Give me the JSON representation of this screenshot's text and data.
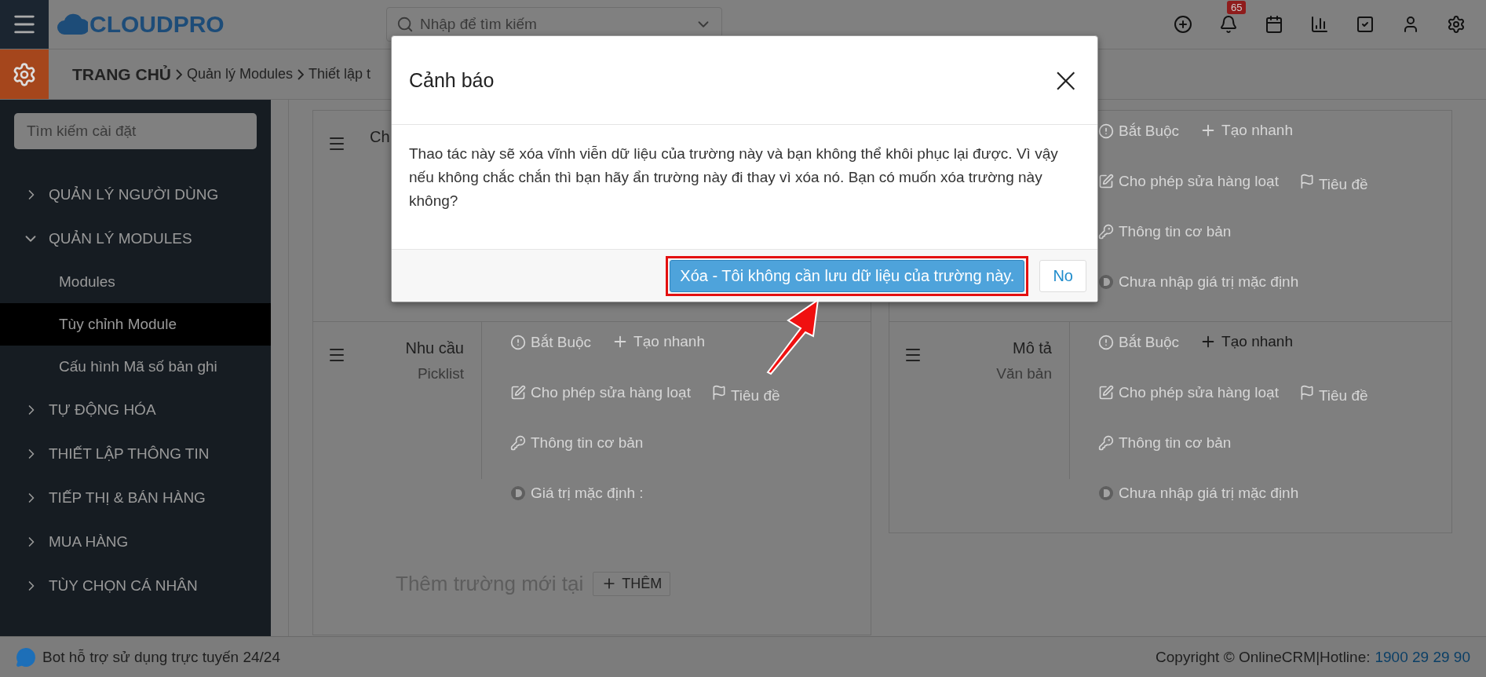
{
  "topbar": {
    "search_placeholder": "Nhập để tìm kiếm",
    "notification_count": "65",
    "logo": "CLOUDPRO"
  },
  "breadcrumb": [
    "TRANG CHỦ",
    "Quản lý Modules",
    "Thiết lập t"
  ],
  "sidebar": {
    "search_placeholder": "Tìm kiếm cài đặt",
    "items": [
      {
        "label": "QUẢN LÝ NGƯỜI DÙNG",
        "expanded": false
      },
      {
        "label": "QUẢN LÝ MODULES",
        "expanded": true,
        "children": [
          {
            "label": "Modules",
            "selected": false
          },
          {
            "label": "Tùy chỉnh Module",
            "selected": true
          },
          {
            "label": "Cấu hình Mã số bản ghi",
            "selected": false
          }
        ]
      },
      {
        "label": "TỰ ĐỘNG HÓA",
        "expanded": false
      },
      {
        "label": "THIẾT LẬP THÔNG TIN",
        "expanded": false
      },
      {
        "label": "TIẾP THỊ & BÁN HÀNG",
        "expanded": false
      },
      {
        "label": "MUA HÀNG",
        "expanded": false
      },
      {
        "label": "TÙY CHỌN CÁ NHÂN",
        "expanded": false
      }
    ]
  },
  "columns": [
    {
      "fields": [
        {
          "name": "Ch"
        },
        {
          "name": "Nhu cầu",
          "type": "Picklist",
          "options": [
            {
              "kind": "required",
              "label": "Bắt Buộc",
              "on": false
            },
            {
              "kind": "quick_create",
              "label": "Tạo nhanh",
              "on": false
            },
            {
              "kind": "mass_edit",
              "label": "Cho phép sửa hàng loạt",
              "on": false
            },
            {
              "kind": "header",
              "label": "Tiêu đề",
              "on": false
            },
            {
              "kind": "basic_info",
              "label": "Thông tin cơ bản",
              "on": false
            },
            {
              "kind": "default",
              "label": "Giá trị mặc định :",
              "on": false
            }
          ]
        }
      ],
      "add_field": {
        "label": "Thêm trường mới tại",
        "button": "THÊM"
      }
    },
    {
      "fields": [
        {
          "options": [
            {
              "kind": "required",
              "label": "Bắt Buộc",
              "on": false
            },
            {
              "kind": "quick_create",
              "label": "Tạo nhanh",
              "on": false
            },
            {
              "kind": "mass_edit",
              "label": "Cho phép sửa hàng loạt",
              "on": false
            },
            {
              "kind": "header",
              "label": "Tiêu đề",
              "on": false
            },
            {
              "kind": "basic_info",
              "label": "Thông tin cơ bản",
              "on": false
            },
            {
              "kind": "default",
              "label": "Chưa nhập giá trị mặc định",
              "on": false
            }
          ]
        },
        {
          "name": "Mô tả",
          "type": "Văn bản",
          "options": [
            {
              "kind": "required",
              "label": "Bắt Buộc",
              "on": false
            },
            {
              "kind": "quick_create",
              "label": "Tạo nhanh",
              "on": true
            },
            {
              "kind": "mass_edit",
              "label": "Cho phép sửa hàng loạt",
              "on": false
            },
            {
              "kind": "header",
              "label": "Tiêu đề",
              "on": false
            },
            {
              "kind": "basic_info",
              "label": "Thông tin cơ bản",
              "on": false
            },
            {
              "kind": "default",
              "label": "Chưa nhập giá trị mặc định",
              "on": false
            }
          ]
        }
      ]
    }
  ],
  "footer": {
    "bot": "Bot hỗ trợ sử dụng trực tuyến 24/24",
    "copyright": "Copyright © OnlineCRM|Hotline:",
    "hotline": "1900 29 29 90"
  },
  "dialog": {
    "title": "Cảnh báo",
    "close": "×",
    "message": "Thao tác này sẽ xóa vĩnh viễn dữ liệu của trường này và bạn không thể khôi phục lại được. Vì vậy nếu không chắc chắn thì bạn hãy ẩn trường này đi thay vì xóa nó. Bạn có muốn xóa trường này không?",
    "confirm": "Xóa - Tôi không cần lưu dữ liệu của trường này.",
    "cancel": "No",
    "confirm_highlighted": true
  }
}
